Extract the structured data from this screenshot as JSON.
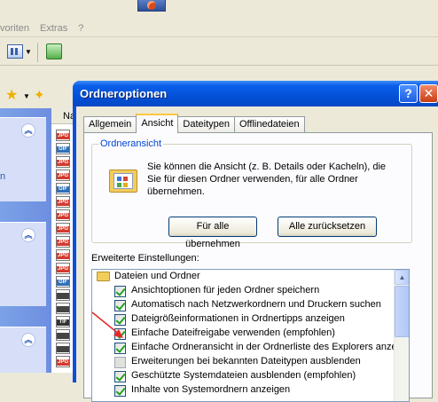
{
  "background": {
    "menu": [
      "voriten",
      "Extras",
      "?"
    ],
    "file_column_header": "Na",
    "file_types": [
      "JPG",
      "GIF",
      "JPG",
      "JPG",
      "GIF",
      "JPG",
      "JPG",
      "JPG",
      "JPG",
      "JPG",
      "JPG",
      "GIF",
      "",
      "",
      "TIF",
      "",
      "",
      "JPG"
    ]
  },
  "dialog": {
    "title": "Ordneroptionen",
    "help_label": "?",
    "close_label": "✕",
    "tabs": [
      "Allgemein",
      "Ansicht",
      "Dateitypen",
      "Offlinedateien"
    ],
    "active_tab": "Ansicht",
    "folder_view": {
      "group_label": "Ordneransicht",
      "description": "Sie können die Ansicht (z. B. Details oder Kacheln), die Sie für diesen Ordner verwenden, für alle Ordner übernehmen.",
      "apply_all": "Für alle übernehmen",
      "reset_all": "Alle zurücksetzen"
    },
    "advanced": {
      "label": "Erweiterte Einstellungen:",
      "root": "Dateien und Ordner",
      "items": [
        {
          "label": "Ansichtoptionen für jeden Ordner speichern",
          "checked": true
        },
        {
          "label": "Automatisch nach Netzwerkordnern und Druckern suchen",
          "checked": true
        },
        {
          "label": "Dateigrößeinformationen in Ordnertipps anzeigen",
          "checked": true
        },
        {
          "label": "Einfache Dateifreigabe verwenden (empfohlen)",
          "checked": true
        },
        {
          "label": "Einfache Ordneransicht in der Ordnerliste des Explorers anzeige",
          "checked": true
        },
        {
          "label": "Erweiterungen bei bekannten Dateitypen ausblenden",
          "checked": false
        },
        {
          "label": "Geschützte Systemdateien ausblenden (empfohlen)",
          "checked": true
        },
        {
          "label": "Inhalte von Systemordnern anzeigen",
          "checked": true
        }
      ]
    }
  },
  "colors": {
    "titlebar": "#0351d8",
    "group_label": "#0046d5",
    "annotation_arrow": "#e8262a"
  }
}
